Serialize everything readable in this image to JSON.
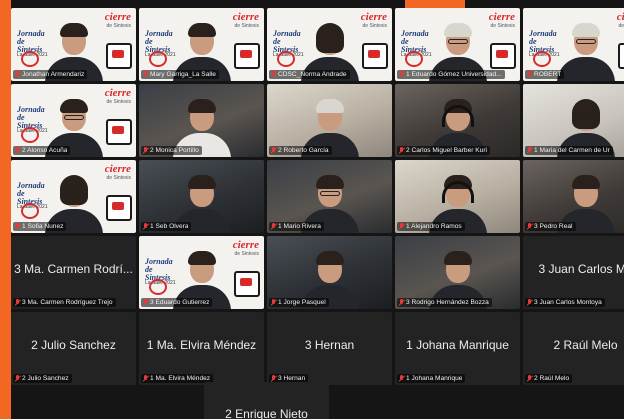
{
  "colors": {
    "accent": "#f26722",
    "background": "#151515",
    "tile": "#232323",
    "muted_mic": "#e23b3b",
    "brand_red": "#d72a2a",
    "brand_blue": "#1f3d7a"
  },
  "branding": {
    "logo": "cierre",
    "logo_sub": "de Sintesis",
    "title": "Jornada de Sintesis",
    "year": "La Salle 2021"
  },
  "participants": [
    {
      "label": "Jonathan Armendariz",
      "center": "",
      "type": "branded"
    },
    {
      "label": "Mary Garriga_La Salle",
      "center": "",
      "type": "branded"
    },
    {
      "label": "CDSC_Norma Andrade",
      "center": "",
      "type": "branded"
    },
    {
      "label": "1 Eduardo Gómez Universidad...",
      "center": "",
      "type": "branded"
    },
    {
      "label": "ROBERT",
      "center": "",
      "type": "branded"
    },
    {
      "label": "2 Alonso Acuña",
      "center": "",
      "type": "branded"
    },
    {
      "label": "2 Monica Portillo",
      "center": "",
      "type": "video"
    },
    {
      "label": "2 Roberto García",
      "center": "",
      "type": "video"
    },
    {
      "label": "2 Carlos Miguel Barber Kuri",
      "center": "",
      "type": "video"
    },
    {
      "label": "1 Maria del Carmen de Ur",
      "center": "",
      "type": "video"
    },
    {
      "label": "1 Sofia Nunez",
      "center": "",
      "type": "branded"
    },
    {
      "label": "1 Seb Olvera",
      "center": "",
      "type": "video"
    },
    {
      "label": "1 Mario Rivera",
      "center": "",
      "type": "video"
    },
    {
      "label": "1 Alejandro Ramos",
      "center": "",
      "type": "video"
    },
    {
      "label": "3 Pedro Real",
      "center": "",
      "type": "video"
    },
    {
      "label": "3 Ma. Carmen Rodríguez Trejo",
      "center": "3 Ma. Carmen Rodrí...",
      "type": "name"
    },
    {
      "label": "3 Eduardo Gutierrez",
      "center": "",
      "type": "branded"
    },
    {
      "label": "1 Jorge Pasquel",
      "center": "",
      "type": "video"
    },
    {
      "label": "3 Rodrigo Hernández Bozza",
      "center": "",
      "type": "video"
    },
    {
      "label": "3 Juan Carlos Montoya",
      "center": "3 Juan Carlos Mo",
      "type": "name"
    },
    {
      "label": "2 Julio Sanchez",
      "center": "2 Julio Sanchez",
      "type": "name"
    },
    {
      "label": "1 Ma. Elvira Méndez",
      "center": "1 Ma. Elvira Méndez",
      "type": "name"
    },
    {
      "label": "3 Hernan",
      "center": "3 Hernan",
      "type": "name"
    },
    {
      "label": "1 Johana Manrique",
      "center": "1 Johana Manrique",
      "type": "name"
    },
    {
      "label": "2 Raúl Melo",
      "center": "2 Raúl Melo",
      "type": "name"
    }
  ],
  "extra_participant": {
    "center": "2 Enrique Nieto"
  }
}
